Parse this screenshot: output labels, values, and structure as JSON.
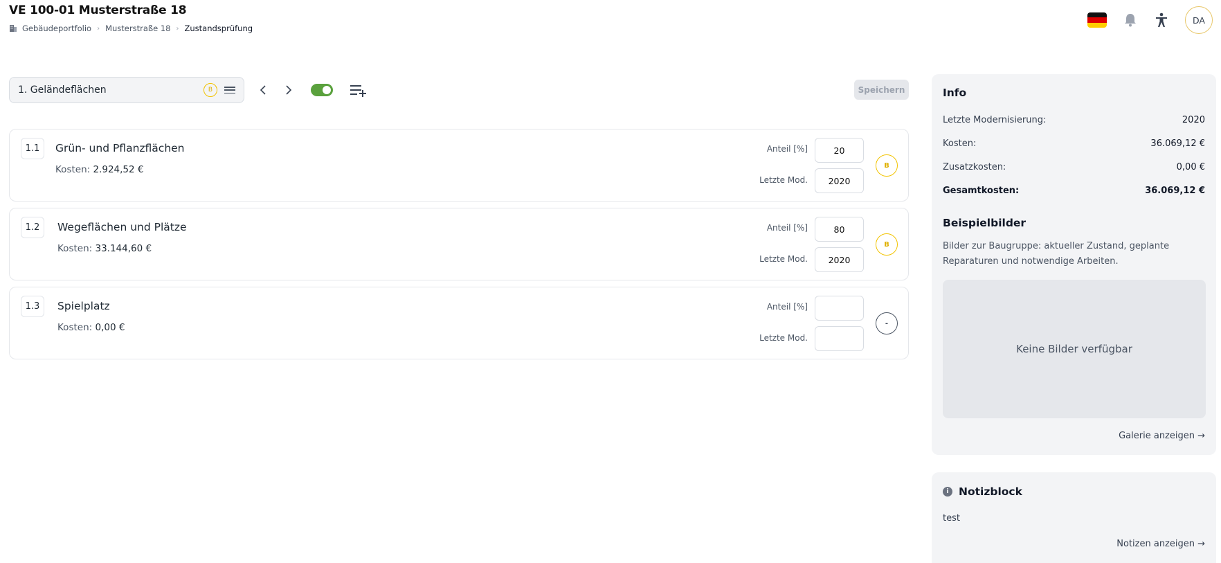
{
  "header": {
    "title": "VE 100-01 Musterstraße 18",
    "breadcrumb": [
      "Gebäudeportfolio",
      "Musterstraße 18",
      "Zustandsprüfung"
    ],
    "avatar": "DA"
  },
  "toolbar": {
    "group_label": "1. Geländeflächen",
    "group_rating": "B",
    "toggle_on": true,
    "save_label": "Speichern"
  },
  "items": [
    {
      "num": "1.1",
      "name": "Grün- und Pflanzflächen",
      "cost_label": "Kosten:",
      "cost_value": "2.924,52 €",
      "share_label": "Anteil [%]",
      "share_value": "20",
      "mod_label": "Letzte Mod.",
      "mod_value": "2020",
      "rating": "B"
    },
    {
      "num": "1.2",
      "name": "Wegeflächen und Plätze",
      "cost_label": "Kosten:",
      "cost_value": "33.144,60 €",
      "share_label": "Anteil [%]",
      "share_value": "80",
      "mod_label": "Letzte Mod.",
      "mod_value": "2020",
      "rating": "B"
    },
    {
      "num": "1.3",
      "name": "Spielplatz",
      "cost_label": "Kosten:",
      "cost_value": "0,00 €",
      "share_label": "Anteil [%]",
      "share_value": "",
      "mod_label": "Letzte Mod.",
      "mod_value": "",
      "rating": "-"
    }
  ],
  "info": {
    "title": "Info",
    "rows": [
      {
        "label": "Letzte Modernisierung:",
        "value": "2020"
      },
      {
        "label": "Kosten:",
        "value": "36.069,12 €"
      },
      {
        "label": "Zusatzkosten:",
        "value": "0,00 €"
      },
      {
        "label": "Gesamtkosten:",
        "value": "36.069,12 €"
      }
    ],
    "examples_title": "Beispielbilder",
    "examples_desc": "Bilder zur Baugruppe: aktueller Zustand, geplante Reparaturen und notwendige Arbeiten.",
    "no_images": "Keine Bilder verfügbar",
    "gallery_link": "Galerie anzeigen →"
  },
  "notes": {
    "title": "Notizblock",
    "text": "test",
    "link": "Notizen anzeigen →"
  },
  "colors": {
    "accent_green": "#5aa13d",
    "rating_b": "#f2c300",
    "panel_bg": "#f3f4f6"
  }
}
